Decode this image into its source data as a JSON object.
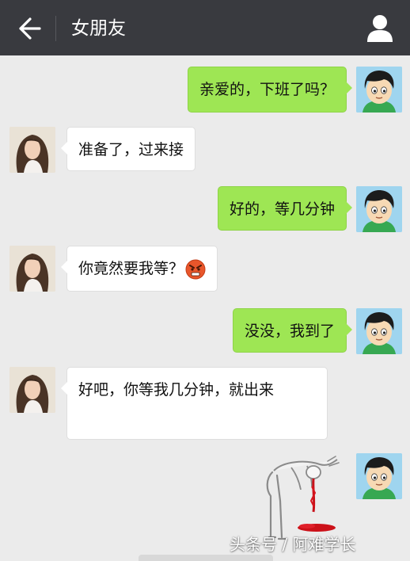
{
  "header": {
    "title": "女朋友",
    "back_icon": "back-arrow-icon",
    "profile_icon": "person-icon"
  },
  "colors": {
    "titlebar": "#393a3f",
    "background": "#ebebeb",
    "bubble_me": "#9ee654",
    "bubble_gf": "#ffffff"
  },
  "messages": [
    {
      "sender": "me",
      "text": "亲爱的，下班了吗？"
    },
    {
      "sender": "girlfriend",
      "text": "准备了，过来接"
    },
    {
      "sender": "me",
      "text": "好的，等几分钟"
    },
    {
      "sender": "girlfriend",
      "text": "你竟然要我等？",
      "emoji": "angry-face"
    },
    {
      "sender": "me",
      "text": "没没，我到了"
    },
    {
      "sender": "girlfriend",
      "text": "好吧，你等我几分钟，就出来"
    },
    {
      "sender": "me",
      "sticker": "man-vomiting-blood-sticker"
    }
  ],
  "watermark": "头条号 / 阿难学长"
}
